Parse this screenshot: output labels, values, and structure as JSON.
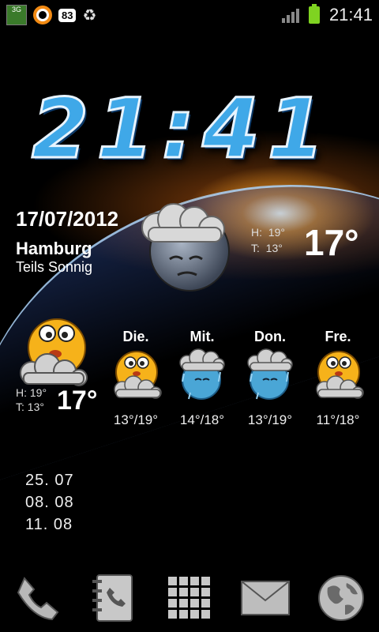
{
  "status_bar": {
    "network_label": "3G",
    "badge_count": "83",
    "time": "21:41",
    "icons": [
      "3g-icon",
      "orange-circle-icon",
      "badge-icon",
      "recycle-icon",
      "signal-icon",
      "battery-icon"
    ]
  },
  "clock": {
    "time": "21:41"
  },
  "weather": {
    "date": "17/07/2012",
    "city": "Hamburg",
    "condition": "Teils Sonnig",
    "high_label": "H:",
    "high_value": "19°",
    "low_label": "T:",
    "low_value": "13°",
    "temperature": "17°",
    "today_small": {
      "high_label": "H:",
      "high_value": "19°",
      "low_label": "T:",
      "low_value": "13°",
      "temperature": "17°"
    },
    "forecast": [
      {
        "day": "Die.",
        "range": "13°/19°",
        "icon": "partly-cloudy-icon"
      },
      {
        "day": "Mit.",
        "range": "14°/18°",
        "icon": "rain-icon"
      },
      {
        "day": "Don.",
        "range": "13°/19°",
        "icon": "rain-icon"
      },
      {
        "day": "Fre.",
        "range": "11°/18°",
        "icon": "partly-cloudy-icon"
      }
    ]
  },
  "dates": [
    "25. 07",
    "08. 08",
    "11. 08"
  ],
  "dock": [
    "phone-icon",
    "contacts-icon",
    "app-drawer-icon",
    "mail-icon",
    "browser-icon"
  ],
  "colors": {
    "clock": "#3fa8e8",
    "battery": "#7fd321",
    "accent_orange": "#f28a13"
  }
}
